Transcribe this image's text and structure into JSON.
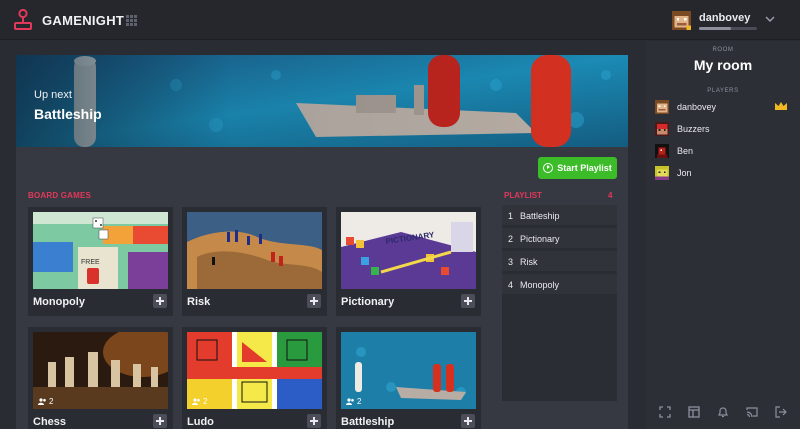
{
  "app": {
    "brand": "GAMENIGHT"
  },
  "user": {
    "name": "danbovey",
    "xp_fraction": 0.55
  },
  "hero": {
    "label": "Up next",
    "title": "Battleship"
  },
  "actions": {
    "start_playlist": "Start Playlist"
  },
  "board_games": {
    "label": "BOARD GAMES",
    "items": [
      {
        "title": "Monopoly"
      },
      {
        "title": "Risk"
      },
      {
        "title": "Pictionary"
      },
      {
        "title": "Chess",
        "players": "2"
      },
      {
        "title": "Ludo",
        "players": "2"
      },
      {
        "title": "Battleship",
        "players": "2"
      }
    ],
    "thumb_text": {
      "pictionary": "PICTIONARY",
      "monopoly_free": "FREE"
    }
  },
  "playlist": {
    "label": "PLAYLIST",
    "count": "4",
    "items": [
      {
        "num": "1",
        "name": "Battleship"
      },
      {
        "num": "2",
        "name": "Pictionary"
      },
      {
        "num": "3",
        "name": "Risk"
      },
      {
        "num": "4",
        "name": "Monopoly"
      }
    ]
  },
  "room": {
    "label": "ROOM",
    "name": "My room",
    "players_label": "PLAYERS",
    "players": [
      {
        "name": "danbovey",
        "host": true
      },
      {
        "name": "Buzzers"
      },
      {
        "name": "Ben"
      },
      {
        "name": "Jon"
      }
    ]
  },
  "colors": {
    "accent": "#e2395a",
    "start_button": "#3bbc28",
    "crown": "#f3b821",
    "background": "#2a2c33",
    "panel": "#363842"
  },
  "icons": {
    "logo": "joystick-logo-icon",
    "apps": "grid-icon",
    "menu": "chevron-down-icon",
    "start": "play-circle-icon",
    "add": "plus-icon",
    "players": "people-icon",
    "host": "crown-icon",
    "footer": [
      "fullscreen-icon",
      "layout-icon",
      "bell-icon",
      "cast-icon",
      "logout-icon"
    ]
  }
}
